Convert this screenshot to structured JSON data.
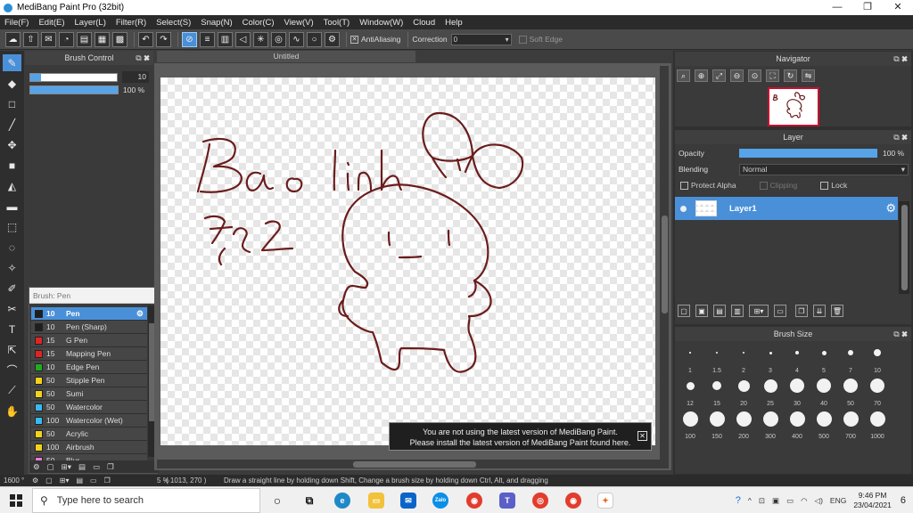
{
  "window": {
    "title": "MediBang Paint Pro (32bit)",
    "minimize": "—",
    "maximize": "❐",
    "close": "✕"
  },
  "menu": [
    "File(F)",
    "Edit(E)",
    "Layer(L)",
    "Filter(R)",
    "Select(S)",
    "Snap(N)",
    "Color(C)",
    "View(V)",
    "Tool(T)",
    "Window(W)",
    "Cloud",
    "Help"
  ],
  "toolbar": {
    "antialiasing_label": "AntiAliasing",
    "antialiasing_checked": true,
    "correction_label": "Correction",
    "correction_value": "0",
    "soft_edge_label": "Soft Edge",
    "soft_edge_checked": false
  },
  "brush_control": {
    "title": "Brush Control",
    "size_value": "10",
    "size_fraction": 0.12,
    "opacity_value": "100 %",
    "opacity_fraction": 1.0
  },
  "brush_list": {
    "header": "Brush: Pen",
    "items": [
      {
        "size": "10",
        "name": "Pen",
        "color": "#1e1e1e",
        "selected": true
      },
      {
        "size": "10",
        "name": "Pen (Sharp)",
        "color": "#1e1e1e",
        "selected": false
      },
      {
        "size": "15",
        "name": "G Pen",
        "color": "#e02424",
        "selected": false
      },
      {
        "size": "15",
        "name": "Mapping Pen",
        "color": "#e02424",
        "selected": false
      },
      {
        "size": "10",
        "name": "Edge Pen",
        "color": "#22aa22",
        "selected": false
      },
      {
        "size": "50",
        "name": "Stipple Pen",
        "color": "#f2d21a",
        "selected": false
      },
      {
        "size": "50",
        "name": "Sumi",
        "color": "#f2d21a",
        "selected": false
      },
      {
        "size": "50",
        "name": "Watercolor",
        "color": "#39b9f0",
        "selected": false
      },
      {
        "size": "100",
        "name": "Watercolor (Wet)",
        "color": "#39b9f0",
        "selected": false
      },
      {
        "size": "50",
        "name": "Acrylic",
        "color": "#f2d21a",
        "selected": false
      },
      {
        "size": "100",
        "name": "Airbrush",
        "color": "#f2d21a",
        "selected": false
      },
      {
        "size": "50",
        "name": "Blur",
        "color": "#f07ad6",
        "selected": false
      }
    ]
  },
  "document": {
    "tab_title": "Untitled"
  },
  "notice": {
    "line1": "You are not using the latest version of MediBang Paint.",
    "line2": "Please install the latest version of MediBang Paint found here."
  },
  "navigator": {
    "title": "Navigator"
  },
  "layer_panel": {
    "title": "Layer",
    "opacity_label": "Opacity",
    "opacity_value": "100 %",
    "blending_label": "Blending",
    "blending_value": "Normal",
    "protect_alpha": "Protect Alpha",
    "clipping": "Clipping",
    "lock": "Lock",
    "layer_name": "Layer1"
  },
  "brush_size": {
    "title": "Brush Size",
    "sizes": [
      "1",
      "1.5",
      "2",
      "3",
      "4",
      "5",
      "7",
      "10",
      "12",
      "15",
      "20",
      "25",
      "30",
      "40",
      "50",
      "70",
      "100",
      "150",
      "200",
      "300",
      "400",
      "500",
      "700",
      "1000"
    ]
  },
  "status": {
    "zoom": "1600 °",
    "percent": "5 %",
    "coords": "( 1013, 270 )",
    "hint": "Draw a straight line by holding down Shift, Change a brush size by holding down Ctrl, Alt, and dragging"
  },
  "taskbar": {
    "search_placeholder": "Type here to search",
    "language": "ENG",
    "time": "9:46 PM",
    "date": "23/04/2021",
    "notification_count": "6",
    "zalo_label": "Zalo"
  },
  "colors": {
    "accent": "#4a90d9",
    "ink": "#6b1c1c"
  }
}
